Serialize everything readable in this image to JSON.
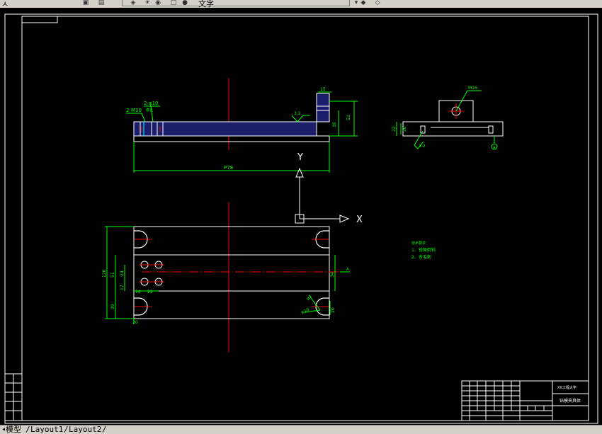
{
  "toolbar": {
    "left_fragment": "ㅅ",
    "text_fragment": "文字",
    "icons": [
      "save-icon",
      "print-icon",
      "layer-icon",
      "sun-icon",
      "lock-icon",
      "color-icon",
      "properties-icon"
    ]
  },
  "drawing": {
    "top_view": {
      "callout_thread": "2-M10",
      "callout_hole": "2-φ10",
      "callout_hole_sub": "锪孔",
      "dim_length": "P78",
      "dim_right_top": "15",
      "dim_height": "52",
      "dim_height_inner": "36",
      "roughness": "3.2"
    },
    "side_view": {
      "callout_thread": "M16",
      "dim_22": "22",
      "dim_20": "20",
      "roughness": "3.2",
      "datum": "A"
    },
    "ucs": {
      "x_label": "X",
      "y_label": "Y"
    },
    "plan_view": {
      "dim_120": "120",
      "dim_51": "51",
      "dim_24": "24",
      "dim_39": "39",
      "dim_17": "17",
      "dim_14": "14",
      "dim_22": "22",
      "dim_right_34": "34",
      "dim_r7": "R7",
      "dim_r10": "R10",
      "dim_20": "20",
      "datum_a": "A"
    },
    "notes": {
      "title": "技术要求",
      "line1": "1、锐角倒钝",
      "line2": "2、去毛刺"
    },
    "title_block": {
      "school": "XX工程大学",
      "part_name": "钻模夹具体"
    }
  },
  "tabs": {
    "model": "模型",
    "layout1": "Layout1",
    "layout2": "Layout2"
  }
}
